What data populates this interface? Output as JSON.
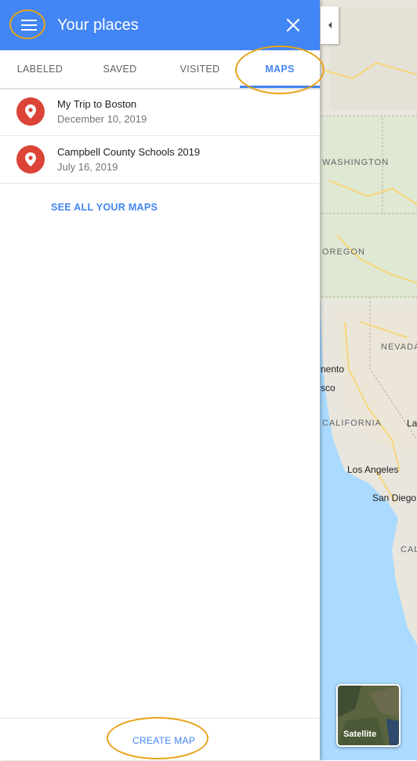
{
  "header": {
    "title": "Your places"
  },
  "tabs": [
    {
      "label": "LABELED"
    },
    {
      "label": "SAVED"
    },
    {
      "label": "VISITED"
    },
    {
      "label": "MAPS"
    }
  ],
  "active_tab": "MAPS",
  "maps": [
    {
      "name": "My Trip to Boston",
      "date": "December 10, 2019"
    },
    {
      "name": "Campbell County Schools 2019",
      "date": "July 16, 2019"
    }
  ],
  "see_all_label": "SEE ALL YOUR MAPS",
  "create_map_label": "CREATE MAP",
  "map": {
    "regions": [
      "WASHINGTON",
      "OREGON",
      "NEVADA",
      "CALIFORNIA",
      "CAL"
    ],
    "cities": [
      "nento",
      "sco",
      "Los Angeles",
      "San Diego",
      "La"
    ],
    "satellite_label": "Satellite"
  },
  "colors": {
    "header_blue": "#4285f4",
    "pin_red": "#db4437",
    "highlight_ring": "#e8a317"
  }
}
